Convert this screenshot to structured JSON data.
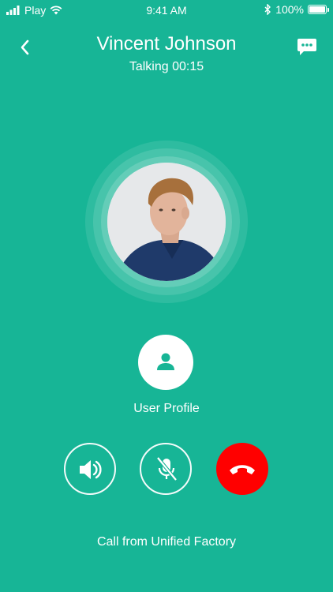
{
  "status_bar": {
    "carrier": "Play",
    "time": "9:41 AM",
    "battery": "100%"
  },
  "header": {
    "contact_name": "Vincent Johnson",
    "call_status": "Talking 00:15"
  },
  "profile": {
    "label": "User Profile"
  },
  "footer": {
    "text": "Call from Unified Factory"
  },
  "colors": {
    "background": "#17b596",
    "hangup": "#ff0000",
    "icon": "#ffffff"
  },
  "icons": {
    "back": "chevron-left-icon",
    "chat": "chat-icon",
    "profile": "person-icon",
    "speaker": "speaker-icon",
    "mute": "mic-off-icon",
    "hangup": "phone-hangup-icon"
  }
}
